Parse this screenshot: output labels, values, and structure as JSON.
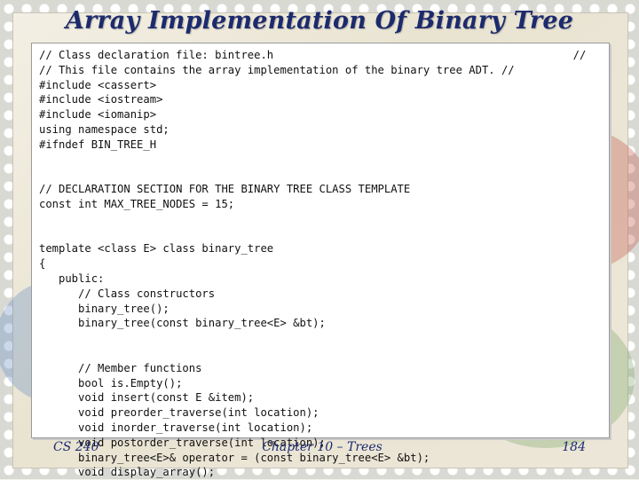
{
  "slide": {
    "title": "Array Implementation Of Binary Tree"
  },
  "code_lines": [
    "// Class declaration file: bintree.h                                              //",
    "// This file contains the array implementation of the binary tree ADT. //",
    "#include <cassert>",
    "#include <iostream>",
    "#include <iomanip>",
    "using namespace std;",
    "#ifndef BIN_TREE_H",
    "",
    "",
    "// DECLARATION SECTION FOR THE BINARY TREE CLASS TEMPLATE",
    "const int MAX_TREE_NODES = 15;",
    "",
    "",
    "template <class E> class binary_tree",
    "{",
    "   public:",
    "      // Class constructors",
    "      binary_tree();",
    "      binary_tree(const binary_tree<E> &bt);",
    "",
    "",
    "      // Member functions",
    "      bool is.Empty();",
    "      void insert(const E &item);",
    "      void preorder_traverse(int location);",
    "      void inorder_traverse(int location);",
    "      void postorder_traverse(int location);",
    "      binary_tree<E>& operator = (const binary_tree<E> &bt);",
    "      void display_array();"
  ],
  "footer": {
    "course": "CS 240",
    "chapter": "Chapter 10 – Trees",
    "page_number": "184"
  }
}
